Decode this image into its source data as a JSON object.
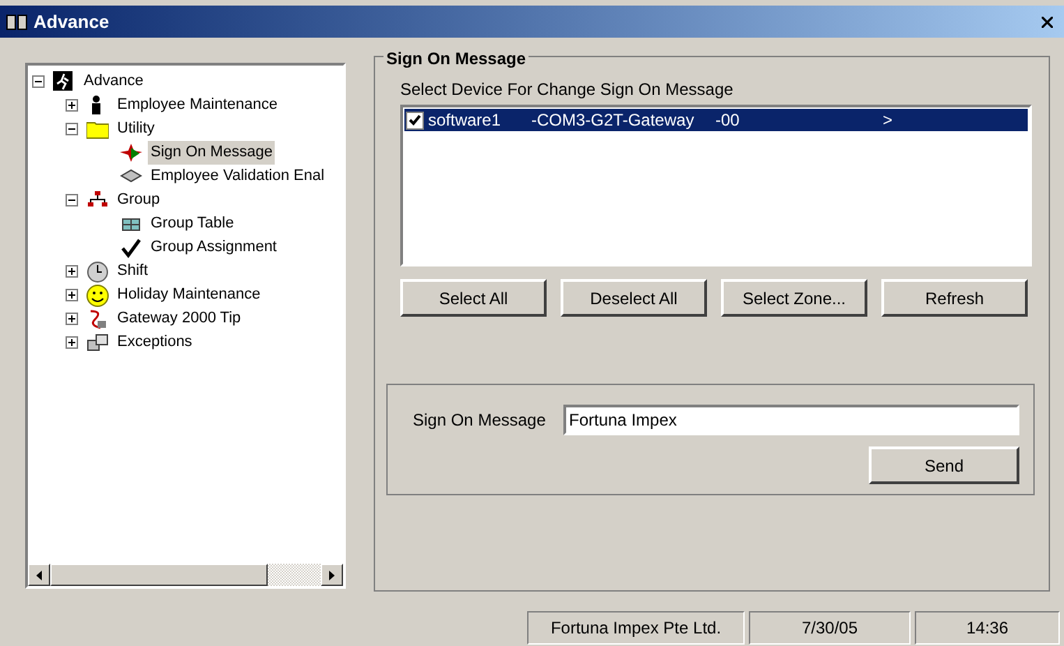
{
  "window": {
    "title": "Advance"
  },
  "tree": [
    {
      "label": "Advance",
      "expanded": true,
      "selected": false,
      "children": [
        {
          "label": "Employee Maintenance",
          "expanded": false,
          "selected": false
        },
        {
          "label": "Utility",
          "expanded": true,
          "selected": false,
          "children": [
            {
              "label": "Sign On Message",
              "selected": true
            },
            {
              "label": "Employee Validation Enal",
              "selected": false
            }
          ]
        },
        {
          "label": "Group",
          "expanded": true,
          "selected": false,
          "children": [
            {
              "label": "Group Table",
              "selected": false
            },
            {
              "label": "Group Assignment",
              "selected": false
            }
          ]
        },
        {
          "label": "Shift",
          "expanded": false,
          "selected": false
        },
        {
          "label": "Holiday Maintenance",
          "expanded": false,
          "selected": false
        },
        {
          "label": "Gateway 2000 Tip",
          "expanded": false,
          "selected": false
        },
        {
          "label": "Exceptions",
          "expanded": false,
          "selected": false
        }
      ]
    }
  ],
  "group": {
    "title": "Sign On Message",
    "list_label": "Select Device For Change Sign On Message",
    "devices": [
      {
        "name": "software1",
        "port": "-COM3-G2T-Gateway",
        "code": "-00",
        "arrow": ">",
        "checked": true,
        "selected": true
      }
    ],
    "buttons": [
      "Select All",
      "Deselect All",
      "Select Zone...",
      "Refresh"
    ],
    "message_label": "Sign On Message",
    "message_value": "Fortuna Impex",
    "send": "Send"
  },
  "status_bar": [
    "Fortuna Impex Pte Ltd.",
    "7/30/05",
    "14:36"
  ]
}
